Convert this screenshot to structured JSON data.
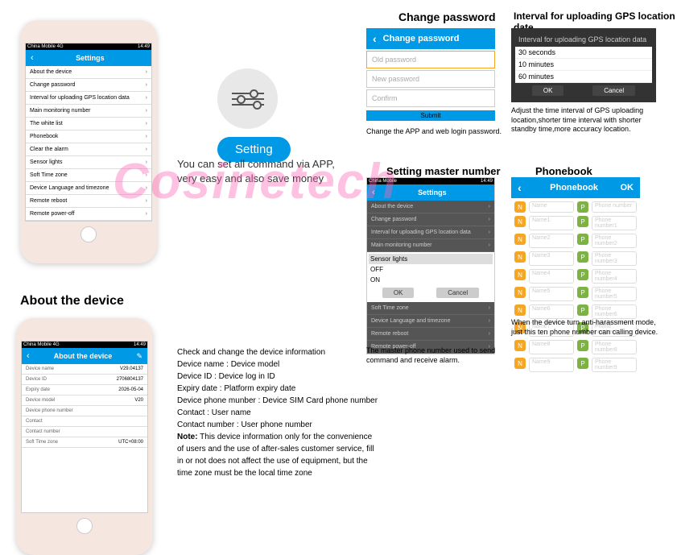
{
  "watermark": "Cosinetech",
  "settings_phone": {
    "status_left": "China Mobile 4G",
    "status_right": "14:49",
    "title": "Settings",
    "items": [
      "About the device",
      "Change password",
      "Interval for uploading GPS location data",
      "Main monitoring number",
      "The white list",
      "Phonebook",
      "Clear the alarm",
      "Sensor lights",
      "Soft Time zone",
      "Device Language and timezone",
      "Remote reboot",
      "Remote power-off"
    ]
  },
  "setting_btn": "Setting",
  "setting_desc1": "You can set all command via APP,",
  "setting_desc2": "very easy and also save money",
  "change_password": {
    "section": "Change password",
    "header": "Change password",
    "old": "Old password",
    "new": "New password",
    "confirm": "Confirm",
    "submit": "Submit",
    "caption": "Change the APP and web login password."
  },
  "interval": {
    "section": "Interval for uploading GPS location date",
    "title": "Interval for uploading GPS location data",
    "opts": [
      "30 seconds",
      "10 minutes",
      "60 minutes"
    ],
    "ok": "OK",
    "cancel": "Cancel",
    "caption": "Adjust the time interval of GPS uploading location,shorter time interval with shorter standby time,more accuracy location."
  },
  "master": {
    "section": "Setting master number",
    "dialog_title": "Sensor lights",
    "opts": [
      "OFF",
      "ON"
    ],
    "ok": "OK",
    "cancel": "Cancel",
    "caption": "The master phone number used to send command and receive alarm."
  },
  "phonebook": {
    "section": "Phonebook",
    "header": "Phonebook",
    "ok": "OK",
    "name_ph": "Name",
    "phone_ph": "Phone number",
    "caption": "When the device turn anti-harassment mode, just this ten phone number can calling device."
  },
  "about": {
    "section": "About the device",
    "header": "About the device",
    "rows": [
      {
        "l": "Device name",
        "v": "V29.04137"
      },
      {
        "l": "Device ID",
        "v": "2706804137"
      },
      {
        "l": "Expiry date",
        "v": "2026-05-04"
      },
      {
        "l": "Device model",
        "v": "V20"
      },
      {
        "l": "Device phone number",
        "v": ""
      },
      {
        "l": "Contact",
        "v": ""
      },
      {
        "l": "Contact number",
        "v": ""
      },
      {
        "l": "Soft Time zone",
        "v": "UTC+08:00"
      }
    ],
    "text": "Check and change the device information\nDevice name : Device model\nDevice ID : Device log in ID\nExpiry date : Platform expiry date\nDevice phone munber : Device SIM Card phone number\nContact : User name\nContact number : User phone number",
    "note_label": "Note:",
    "note": " This device information only for the convenience of users and the use of after-sales customer service, fill in or not does not affect the use of equipment, but the time zone must be the local time zone"
  }
}
